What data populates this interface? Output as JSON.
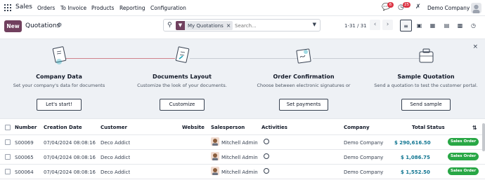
{
  "topbar": {
    "app": "Sales",
    "menu": [
      "Orders",
      "To Invoice",
      "Products",
      "Reporting",
      "Configuration"
    ],
    "msg_badge": "6",
    "activity_badge": "25",
    "company": "Demo Company"
  },
  "control": {
    "new_label": "New",
    "title": "Quotations",
    "facet": "My Quotations",
    "search_placeholder": "Search...",
    "pager": "1-31 / 31"
  },
  "onboarding": {
    "steps": [
      {
        "title": "Company Data",
        "desc": "Set your company's data for documents header/footer.",
        "button": "Let's start!"
      },
      {
        "title": "Documents Layout",
        "desc": "Customize the look of your documents.",
        "button": "Customize"
      },
      {
        "title": "Order Confirmation",
        "desc": "Choose between electronic signatures or online payments.",
        "button": "Set payments"
      },
      {
        "title": "Sample Quotation",
        "desc": "Send a quotation to test the customer portal.",
        "button": "Send sample"
      }
    ]
  },
  "table": {
    "headers": {
      "number": "Number",
      "creation_date": "Creation Date",
      "customer": "Customer",
      "website": "Website",
      "salesperson": "Salesperson",
      "activities": "Activities",
      "company": "Company",
      "total": "Total",
      "status": "Status"
    },
    "rows": [
      {
        "number": "S00069",
        "date": "07/04/2024 08:08:16",
        "customer": "Deco Addict",
        "salesperson": "Mitchell Admin",
        "company": "Demo Company",
        "total": "$ 290,616.50",
        "status": "Sales Order"
      },
      {
        "number": "S00065",
        "date": "07/04/2024 08:08:16",
        "customer": "Deco Addict",
        "salesperson": "Mitchell Admin",
        "company": "Demo Company",
        "total": "$ 1,086.75",
        "status": "Sales Order"
      },
      {
        "number": "S00064",
        "date": "07/04/2024 08:08:16",
        "customer": "Deco Addict",
        "salesperson": "Mitchell Admin",
        "company": "Demo Company",
        "total": "$ 1,552.50",
        "status": "Sales Order"
      }
    ]
  },
  "colors": {
    "brand": "#71405e",
    "status_green": "#28a745",
    "amount": "#0e7490"
  }
}
